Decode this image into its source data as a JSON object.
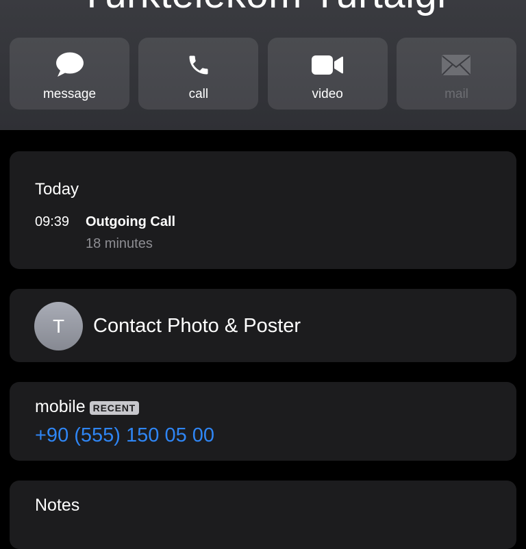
{
  "contact": {
    "name": "Türktelekom Turtalgi",
    "initial": "T"
  },
  "actions": [
    {
      "label": "message",
      "icon": "message-bubble-icon",
      "enabled": true
    },
    {
      "label": "call",
      "icon": "phone-icon",
      "enabled": true
    },
    {
      "label": "video",
      "icon": "video-camera-icon",
      "enabled": true
    },
    {
      "label": "mail",
      "icon": "envelope-icon",
      "enabled": false
    }
  ],
  "history": {
    "day": "Today",
    "time": "09:39",
    "type": "Outgoing Call",
    "duration": "18 minutes"
  },
  "photo_poster": {
    "label": "Contact Photo & Poster"
  },
  "phone": {
    "label": "mobile",
    "badge": "RECENT",
    "number": "+90 (555) 150 05 00"
  },
  "notes": {
    "label": "Notes"
  },
  "colors": {
    "background": "#000000",
    "card": "#1c1c1e",
    "link": "#2f86f5",
    "secondary_text": "#8e8e93",
    "disabled_text": "#6d6e73"
  }
}
